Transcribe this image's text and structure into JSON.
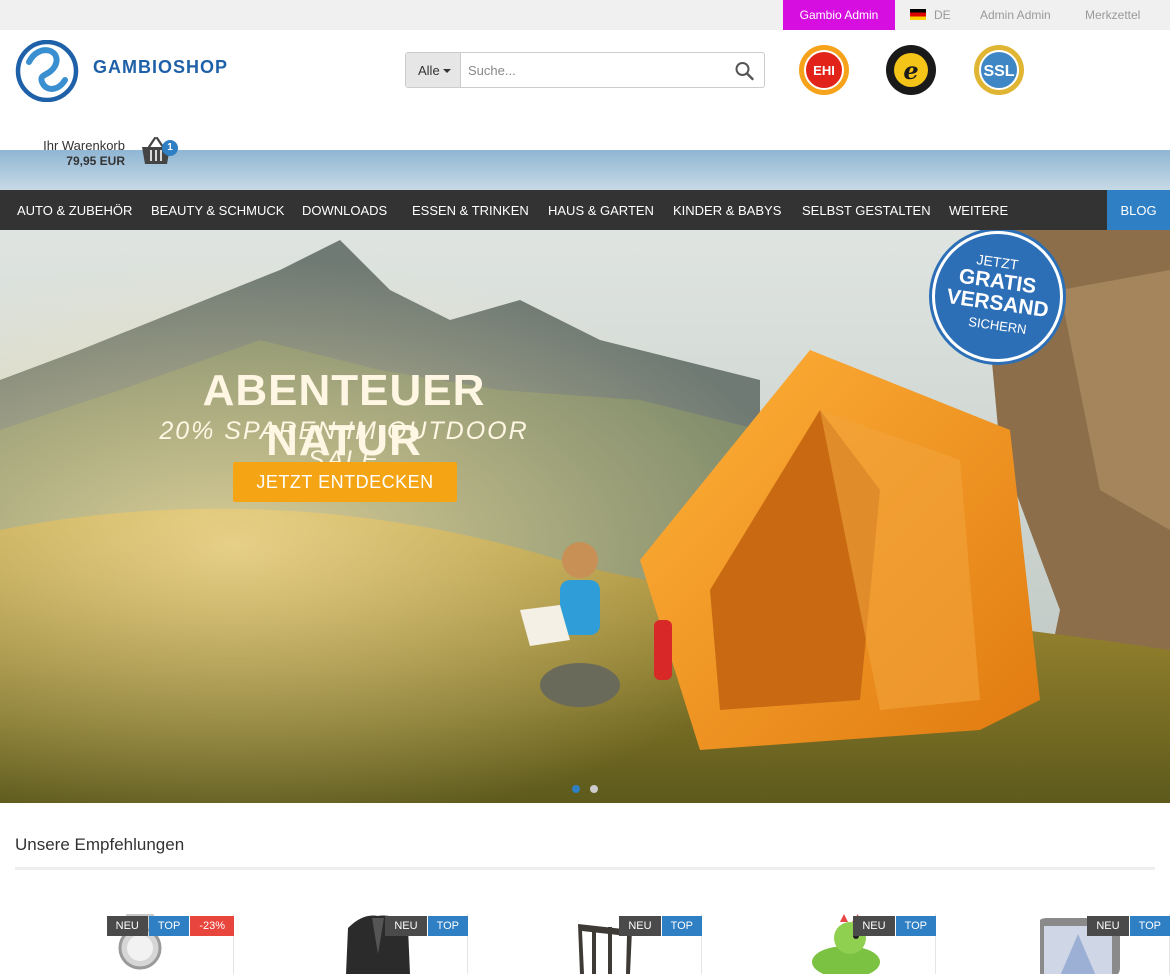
{
  "topbar": {
    "admin_label": "Gambio Admin",
    "language": "DE",
    "user": "Admin Admin",
    "wishlist": "Merkzettel"
  },
  "logo": {
    "wordmark": "GAMBIOSHOP"
  },
  "search": {
    "category": "Alle",
    "placeholder": "Suche..."
  },
  "seals": [
    {
      "icon": "ehi-seal-icon",
      "text": "EHI"
    },
    {
      "icon": "trusted-shops-seal-icon",
      "text": "e"
    },
    {
      "icon": "ssl-seal-icon",
      "text": "SSL"
    }
  ],
  "cart": {
    "label": "Ihr Warenkorb",
    "total": "79,95 EUR",
    "count": "1"
  },
  "nav": {
    "items": [
      "AUTO & ZUBEHÖR",
      "BEAUTY & SCHMUCK",
      "DOWNLOADS",
      "ESSEN & TRINKEN",
      "HAUS & GARTEN",
      "KINDER & BABYS",
      "SELBST GESTALTEN",
      "WEITERE"
    ],
    "blog": "BLOG"
  },
  "hero": {
    "title": "ABENTEUER NATUR",
    "subtitle": "20% SPAREN IM OUTDOOR SALE",
    "cta": "JETZT ENTDECKEN",
    "badge": [
      "JETZT",
      "GRATIS",
      "VERSAND",
      "SICHERN"
    ],
    "slides": 2,
    "active_slide": 1
  },
  "recommendations": {
    "title": "Unsere Empfehlungen",
    "products": [
      {
        "ribbons": [
          "NEU",
          "TOP",
          "-23%"
        ],
        "thumb": "watch-icon"
      },
      {
        "ribbons": [
          "NEU",
          "TOP"
        ],
        "thumb": "cardigan-icon"
      },
      {
        "ribbons": [
          "NEU",
          "TOP"
        ],
        "thumb": "chair-icon"
      },
      {
        "ribbons": [
          "NEU",
          "TOP"
        ],
        "thumb": "dragon-toy-icon"
      },
      {
        "ribbons": [
          "NEU",
          "TOP"
        ],
        "thumb": "navigation-device-icon"
      }
    ]
  },
  "colors": {
    "admin": "#d60fe0",
    "accent": "#2f7fc4",
    "nav": "#333333",
    "cta": "#f5a514",
    "sale": "#e8453c"
  }
}
